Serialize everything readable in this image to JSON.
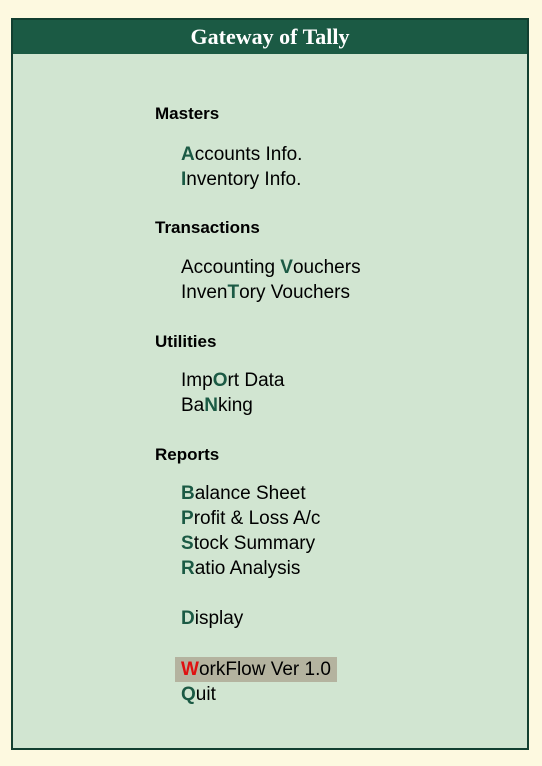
{
  "window": {
    "title": "Gateway of Tally"
  },
  "colors": {
    "title_bg": "#1b5a44",
    "panel_bg": "#d1e5d1",
    "hotkey": "#1b5a44",
    "selected_hotkey": "#e01010",
    "selected_bg": "#b4b39f"
  },
  "sections": {
    "masters": {
      "heading": "Masters",
      "items": [
        {
          "pre": "",
          "key": "A",
          "post": "ccounts Info."
        },
        {
          "pre": "",
          "key": "I",
          "post": "nventory Info."
        }
      ]
    },
    "transactions": {
      "heading": "Transactions",
      "items": [
        {
          "pre": "Accounting ",
          "key": "V",
          "post": "ouchers"
        },
        {
          "pre": "Inven",
          "key": "T",
          "post": "ory Vouchers"
        }
      ]
    },
    "utilities": {
      "heading": "Utilities",
      "items": [
        {
          "pre": "Imp",
          "key": "O",
          "post": "rt Data"
        },
        {
          "pre": "Ba",
          "key": "N",
          "post": "king"
        }
      ]
    },
    "reports": {
      "heading": "Reports",
      "items": [
        {
          "pre": "",
          "key": "B",
          "post": "alance Sheet"
        },
        {
          "pre": "",
          "key": "P",
          "post": "rofit & Loss A/c"
        },
        {
          "pre": "",
          "key": "S",
          "post": "tock Summary"
        },
        {
          "pre": "",
          "key": "R",
          "post": "atio Analysis"
        }
      ]
    }
  },
  "extra": {
    "display": {
      "pre": "",
      "key": "D",
      "post": "isplay"
    },
    "workflow": {
      "pre": "",
      "key": "W",
      "post": "orkFlow Ver 1.0",
      "selected": true
    },
    "quit": {
      "pre": "",
      "key": "Q",
      "post": "uit"
    }
  }
}
